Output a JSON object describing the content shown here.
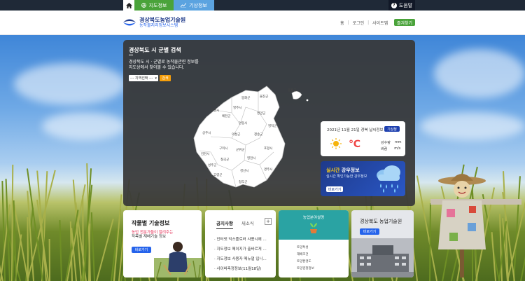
{
  "topbar": {
    "tab_map": "지도정보",
    "tab_weather": "기상정보",
    "help": "도움말"
  },
  "header": {
    "logo_title": "경상북도농업기술원",
    "logo_subtitle": "농작물지리정보시스템",
    "nav": [
      "홈",
      "로그인",
      "사이트맵"
    ],
    "favorite": "즐겨찾기"
  },
  "map_panel": {
    "title": "경상북도 시 군별 검색",
    "desc_line1": "경상북도 시 · 군별로 농작물관련 정보를",
    "desc_line2": "지도상에서 찾아볼 수 있습니다.",
    "select_value": "--- 지역선택 ---",
    "search_label": "검색",
    "regions": [
      "울릉군",
      "봉화군",
      "울진군",
      "영주시",
      "문경시",
      "예천군",
      "영양군",
      "안동시",
      "상주시",
      "의성군",
      "영덕군",
      "청송군",
      "김천시",
      "구미시",
      "군위군",
      "포항시",
      "칠곡군",
      "영천시",
      "성주군",
      "경산시",
      "경주시",
      "고령군",
      "청도군"
    ]
  },
  "weather_card": {
    "date": "2021년 11월 21일 경북 날씨정보",
    "button": "기상청",
    "temp_unit": "℃",
    "precip_label": "강수량",
    "precip_unit": "mm",
    "wind_label": "바람",
    "wind_unit": "m/s"
  },
  "rain_card": {
    "title_highlight": "실시간",
    "title_rest": " 강우정보",
    "subtitle": "실시간 확인가능한 강우정보",
    "button": "바로가기"
  },
  "card_crop": {
    "title": "작물별 기술정보",
    "desc_highlight": "농업 전문가들이 알려주는",
    "desc_plain": "작목별 재배기술 정보",
    "button": "바로가기"
  },
  "card_notice": {
    "tab_active": "공지사항",
    "tab_other": "새소식",
    "plus": "+",
    "items": [
      "인터넷 익스플로러 사용시에 ...",
      "지도정보 메이지가 출바르게 ...",
      "지도정보 사용자 메뉴얼 입니...",
      "사이버측정정보(11월18일)"
    ]
  },
  "card_analysis": {
    "title": "농업분야설명",
    "items": [
      "토양특성",
      "재배조건",
      "토양환경도",
      "토양검정정보"
    ]
  },
  "card_institute": {
    "title": "경상북도 농업기술원",
    "button": "바로가기"
  },
  "colors": {
    "green": "#4aa33a",
    "blue": "#5ba3e0",
    "orange": "#f59e0b",
    "navy": "#1e40af",
    "teal": "#2aa3a3"
  }
}
